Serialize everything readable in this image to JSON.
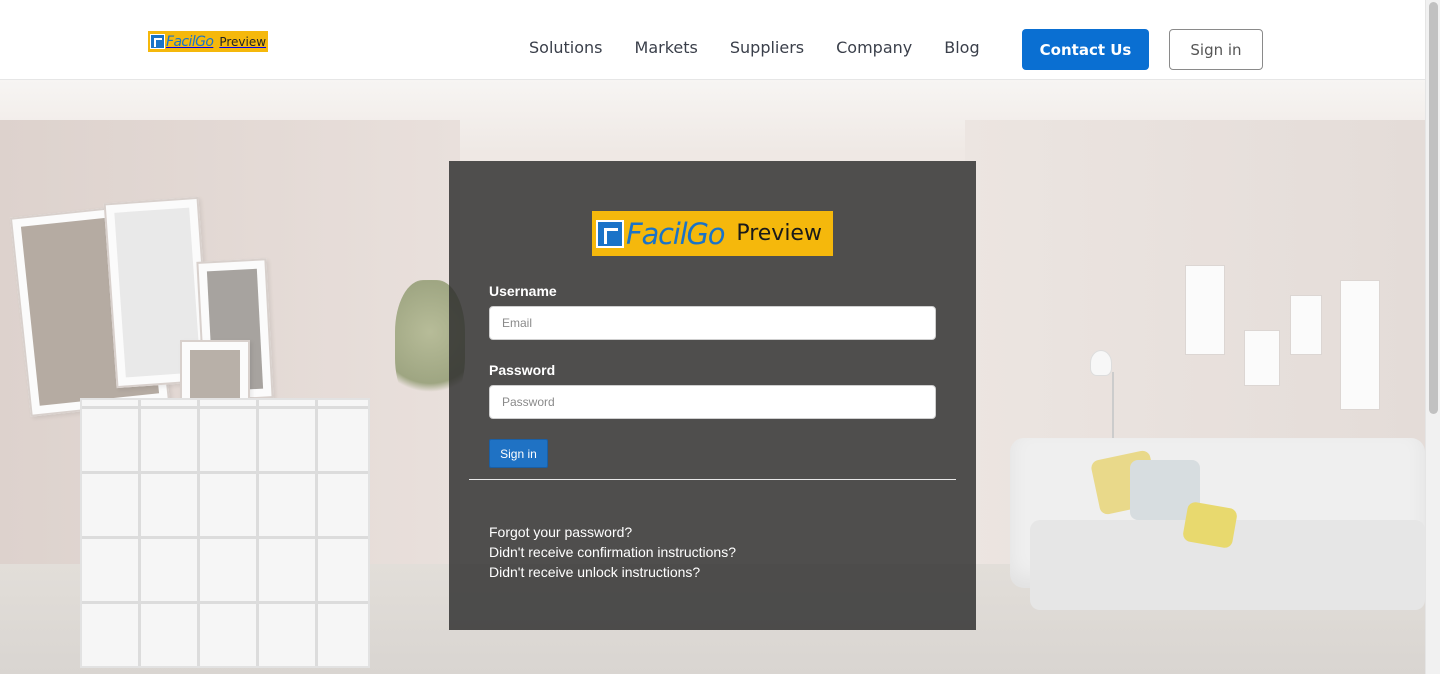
{
  "brand": {
    "logo_word": "FacilGo",
    "logo_suffix": "Preview",
    "accent_color": "#f5b80c",
    "primary_color": "#0a6fd2"
  },
  "header": {
    "nav": [
      {
        "label": "Solutions"
      },
      {
        "label": "Markets"
      },
      {
        "label": "Suppliers"
      },
      {
        "label": "Company"
      },
      {
        "label": "Blog"
      }
    ],
    "contact_label": "Contact Us",
    "signin_label": "Sign in"
  },
  "login": {
    "username_label": "Username",
    "username_placeholder": "Email",
    "password_label": "Password",
    "password_placeholder": "Password",
    "submit_label": "Sign in",
    "links": {
      "forgot": "Forgot your password?",
      "confirmation": "Didn't receive confirmation instructions?",
      "unlock": "Didn't receive unlock instructions?"
    }
  },
  "icons": {
    "logo_mark": "facilgo-logo-icon"
  }
}
